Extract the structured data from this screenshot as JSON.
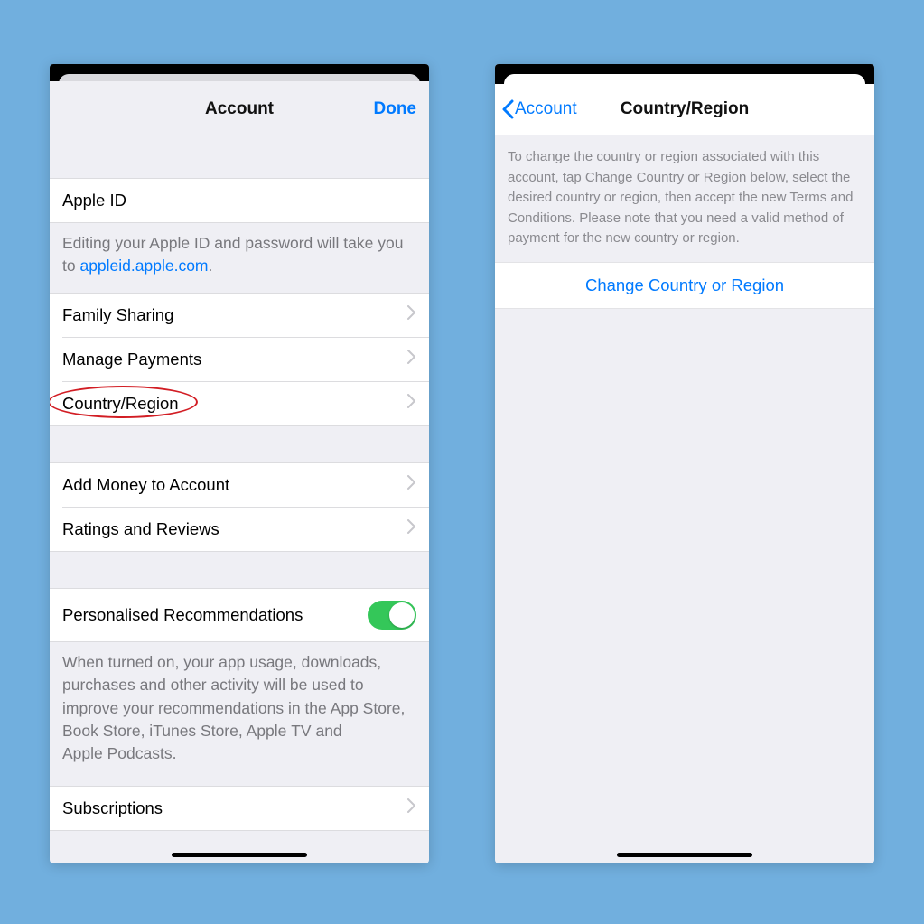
{
  "colors": {
    "accent": "#007aff",
    "toggle_on": "#34c759",
    "ring": "#d21d24"
  },
  "left": {
    "nav": {
      "title": "Account",
      "done": "Done"
    },
    "apple_id": {
      "label": "Apple ID",
      "footer_pre": "Editing your Apple ID and password will take you to ",
      "footer_link": "appleid.apple.com",
      "footer_post": "."
    },
    "rows1": {
      "family_sharing": "Family Sharing",
      "manage_payments": "Manage Payments",
      "country_region": "Country/Region"
    },
    "rows2": {
      "add_money": "Add Money to Account",
      "ratings_reviews": "Ratings and Reviews"
    },
    "recs": {
      "label": "Personalised Recommendations",
      "footer": "When turned on, your app usage, downloads, purchases and other activity will be used to improve your recommendations in the App Store, Book Store, iTunes Store, Apple TV and Apple Podcasts."
    },
    "rows3": {
      "subscriptions": "Subscriptions"
    }
  },
  "right": {
    "nav": {
      "back": "Account",
      "title": "Country/Region"
    },
    "info": "To change the country or region associated with this account, tap Change Country or Region below, select the desired country or region, then accept the new Terms and Conditions. Please note that you need a valid method of payment for the new country or region.",
    "button": "Change Country or Region"
  }
}
